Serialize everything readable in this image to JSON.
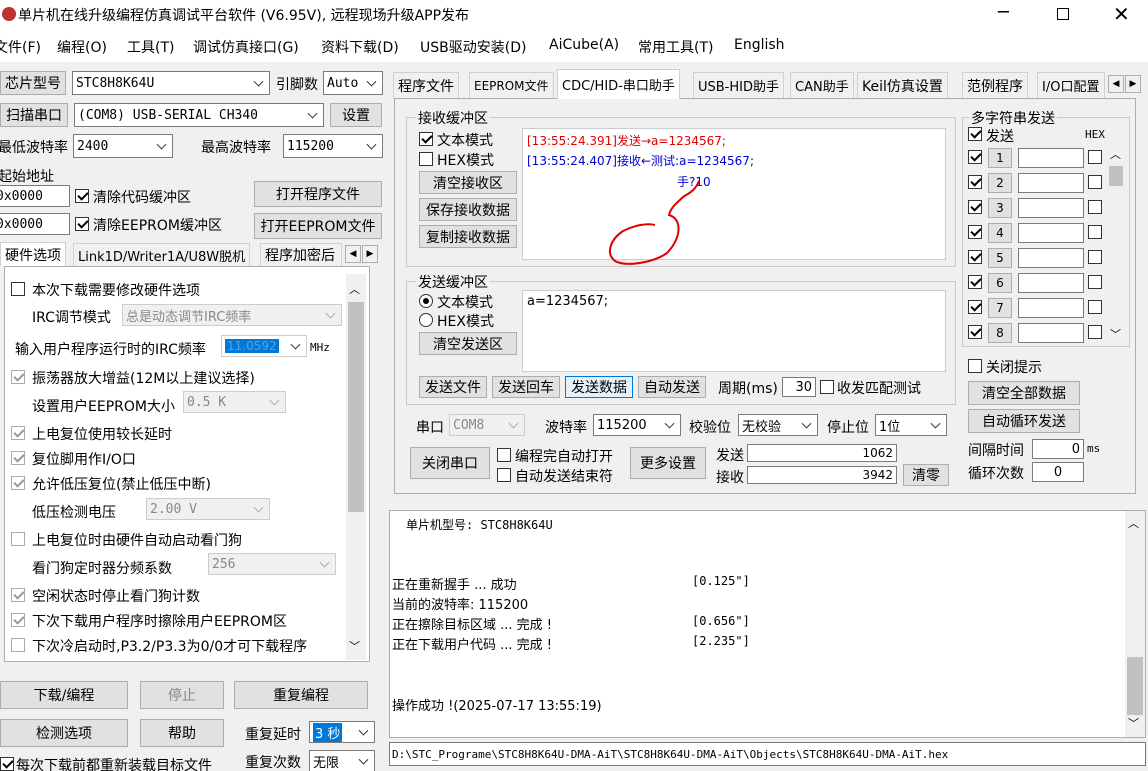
{
  "window": {
    "title": "单片机在线升级编程仿真调试平台软件 (V6.95V), 远程现场升级APP发布"
  },
  "menu": [
    "文件(F)",
    "编程(O)",
    "工具(T)",
    "调试仿真接口(G)",
    "资料下载(D)",
    "USB驱动安装(D)",
    "AiCube(A)",
    "常用工具(T)",
    "English"
  ],
  "left": {
    "chip_label": "芯片型号",
    "chip_value": "STC8H8K64U",
    "pin_label": "引脚数",
    "pin_value": "Auto",
    "scan_label": "扫描串口",
    "port_value": "(COM8) USB-SERIAL CH340",
    "settings_label": "设置",
    "min_baud_label": "最低波特率",
    "min_baud_value": "2400",
    "max_baud_label": "最高波特率",
    "max_baud_value": "115200",
    "start_addr_label": "起始地址",
    "addr1": "0x0000",
    "clear_code_label": "清除代码缓冲区",
    "open_prog_label": "打开程序文件",
    "addr2": "0x0000",
    "clear_eeprom_label": "清除EEPROM缓冲区",
    "open_eeprom_label": "打开EEPROM文件",
    "tabs": [
      "硬件选项",
      "Link1D/Writer1A/U8W脱机",
      "程序加密后"
    ],
    "hw": {
      "modify_label": "本次下载需要修改硬件选项",
      "irc_mode_label": "IRC调节模式",
      "irc_mode_value": "总是动态调节IRC频率",
      "irc_freq_label": "输入用户程序运行时的IRC频率",
      "irc_freq_value": "11.0592",
      "irc_unit": "MHz",
      "osc_gain_label": "振荡器放大增益(12M以上建议选择)",
      "eeprom_size_label": "设置用户EEPROM大小",
      "eeprom_size_value": "0.5 K",
      "long_delay_label": "上电复位使用较长延时",
      "reset_io_label": "复位脚用作I/O口",
      "lvd_reset_label": "允许低压复位(禁止低压中断)",
      "lvd_voltage_label": "低压检测电压",
      "lvd_voltage_value": "2.00 V",
      "wdt_auto_label": "上电复位时由硬件自动启动看门狗",
      "wdt_div_label": "看门狗定时器分频系数",
      "wdt_div_value": "256",
      "idle_wdt_label": "空闲状态时停止看门狗计数",
      "erase_eeprom_label": "下次下载用户程序时擦除用户EEPROM区",
      "p32_label": "下次冷启动时,P3.2/P3.3为0/0才可下载程序"
    },
    "download_label": "下载/编程",
    "stop_label": "停止",
    "repeat_prog_label": "重复编程",
    "check_label": "检测选项",
    "help_label": "帮助",
    "repeat_delay_label": "重复延时",
    "repeat_delay_value": "3 秒",
    "reload_label": "每次下载前都重新装载目标文件",
    "repeat_count_label": "重复次数",
    "repeat_count_value": "无限"
  },
  "right_tabs": [
    "程序文件",
    "EEPROM文件",
    "CDC/HID-串口助手",
    "USB-HID助手",
    "CAN助手",
    "Keil仿真设置",
    "范例程序",
    "I/O口配置"
  ],
  "recv": {
    "group_label": "接收缓冲区",
    "text_mode": "文本模式",
    "hex_mode": "HEX模式",
    "clear_label": "清空接收区",
    "save_label": "保存接收数据",
    "copy_label": "复制接收数据",
    "line1_time": "[13:55:24.391]",
    "line1_dir": "发送→",
    "line1_data": "a=1234567;",
    "line2_time": "[13:55:24.407]",
    "line2_dir": "接收←",
    "line2_data": "测试:a=1234567;",
    "line3_data": "手?10"
  },
  "send": {
    "group_label": "发送缓冲区",
    "text_mode": "文本模式",
    "hex_mode": "HEX模式",
    "clear_label": "清空发送区",
    "content": "a=1234567;",
    "send_file": "发送文件",
    "send_enter": "发送回车",
    "send_data": "发送数据",
    "auto_send": "自动发送",
    "period_label": "周期(ms)",
    "period_value": "30",
    "match_label": "收发匹配测试"
  },
  "port": {
    "port_label": "串口",
    "port_value": "COM8",
    "baud_label": "波特率",
    "baud_value": "115200",
    "parity_label": "校验位",
    "parity_value": "无校验",
    "stop_label": "停止位",
    "stop_value": "1位",
    "close_label": "关闭串口",
    "auto_open_label": "编程完自动打开",
    "auto_send_end_label": "自动发送结束符",
    "more_label": "更多设置",
    "tx_label": "发送",
    "tx_value": "1062",
    "rx_label": "接收",
    "rx_value": "3942",
    "clear_count_label": "清零"
  },
  "multi": {
    "group_label": "多字符串发送",
    "send_label": "发送",
    "hex_label": "HEX",
    "rows": [
      "1",
      "2",
      "3",
      "4",
      "5",
      "6",
      "7",
      "8"
    ],
    "close_tip_label": "关闭提示",
    "clear_all_label": "清空全部数据",
    "auto_loop_label": "自动循环发送",
    "interval_label": "间隔时间",
    "interval_value": "0",
    "interval_unit": "ms",
    "loop_label": "循环次数",
    "loop_value": "0"
  },
  "log": {
    "chip_line": "单片机型号: STC8H8K64U",
    "lines": [
      {
        "text": "正在重新握手 ... 成功",
        "time": "[0.125\"]"
      },
      {
        "text": "当前的波特率: 115200",
        "time": ""
      },
      {
        "text": "正在擦除目标区域 ... 完成 !",
        "time": "[0.656\"]"
      },
      {
        "text": "正在下载用户代码 ... 完成 !",
        "time": "[2.235\"]"
      }
    ],
    "result": "操作成功 !(2025-07-17 13:55:19)"
  },
  "status_path": "D:\\STC_Programe\\STC8H8K64U-DMA-AiT\\STC8H8K64U-DMA-AiT\\Objects\\STC8H8K64U-DMA-AiT.hex",
  "colors": {
    "red": "#e00000",
    "blue": "#0000d0",
    "select": "#0078d7"
  }
}
